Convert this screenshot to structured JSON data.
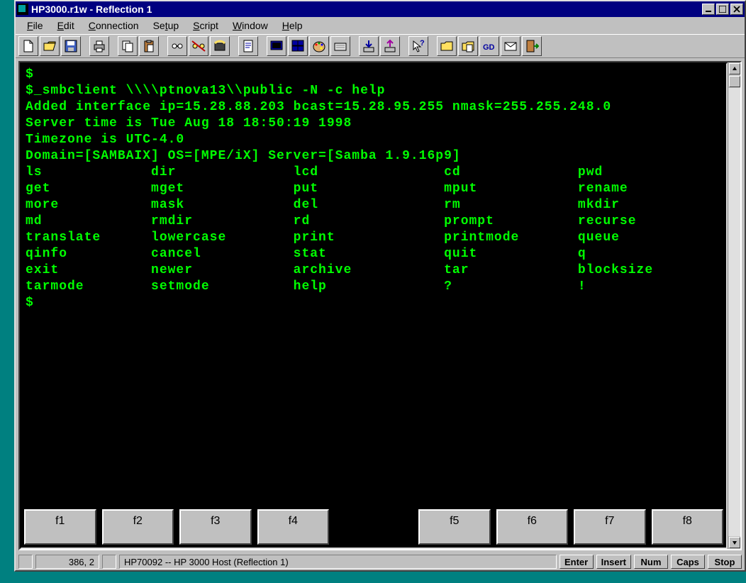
{
  "window": {
    "title": "HP3000.r1w - Reflection 1"
  },
  "menu": {
    "file": {
      "label": "File",
      "ul": "F"
    },
    "edit": {
      "label": "Edit",
      "ul": "E"
    },
    "conn": {
      "label": "Connection",
      "ul": "C"
    },
    "setup": {
      "label": "Setup",
      "ul": "t"
    },
    "script": {
      "label": "Script",
      "ul": "S"
    },
    "window": {
      "label": "Window",
      "ul": "W"
    },
    "help": {
      "label": "Help",
      "ul": "H"
    }
  },
  "terminal": {
    "prompt1": "$",
    "command": "$_smbclient \\\\\\\\ptnova13\\\\public -N -c help",
    "line_added": "Added interface ip=15.28.88.203 bcast=15.28.95.255 nmask=255.255.248.0",
    "line_time": "Server time is Tue Aug 18 18:50:19 1998",
    "line_tz": "Timezone is UTC-4.0",
    "line_domain": "Domain=[SAMBAIX] OS=[MPE/iX] Server=[Samba 1.9.16p9]",
    "cmds": [
      [
        "ls",
        "dir",
        "lcd",
        "cd",
        "pwd"
      ],
      [
        "get",
        "mget",
        "put",
        "mput",
        "rename"
      ],
      [
        "more",
        "mask",
        "del",
        "rm",
        "mkdir"
      ],
      [
        "md",
        "rmdir",
        "rd",
        "prompt",
        "recurse"
      ],
      [
        "translate",
        "lowercase",
        "print",
        "printmode",
        "queue"
      ],
      [
        "qinfo",
        "cancel",
        "stat",
        "quit",
        "q"
      ],
      [
        "exit",
        "newer",
        "archive",
        "tar",
        "blocksize"
      ],
      [
        "tarmode",
        "setmode",
        "help",
        "?",
        "!"
      ]
    ],
    "prompt2": "$"
  },
  "fkeys": {
    "f1": "f1",
    "f2": "f2",
    "f3": "f3",
    "f4": "f4",
    "f5": "f5",
    "f6": "f6",
    "f7": "f7",
    "f8": "f8"
  },
  "status": {
    "pos": "386, 2",
    "host": "HP70092 -- HP 3000 Host (Reflection 1)",
    "enter": "Enter",
    "insert": "Insert",
    "num": "Num",
    "caps": "Caps",
    "stop": "Stop"
  }
}
